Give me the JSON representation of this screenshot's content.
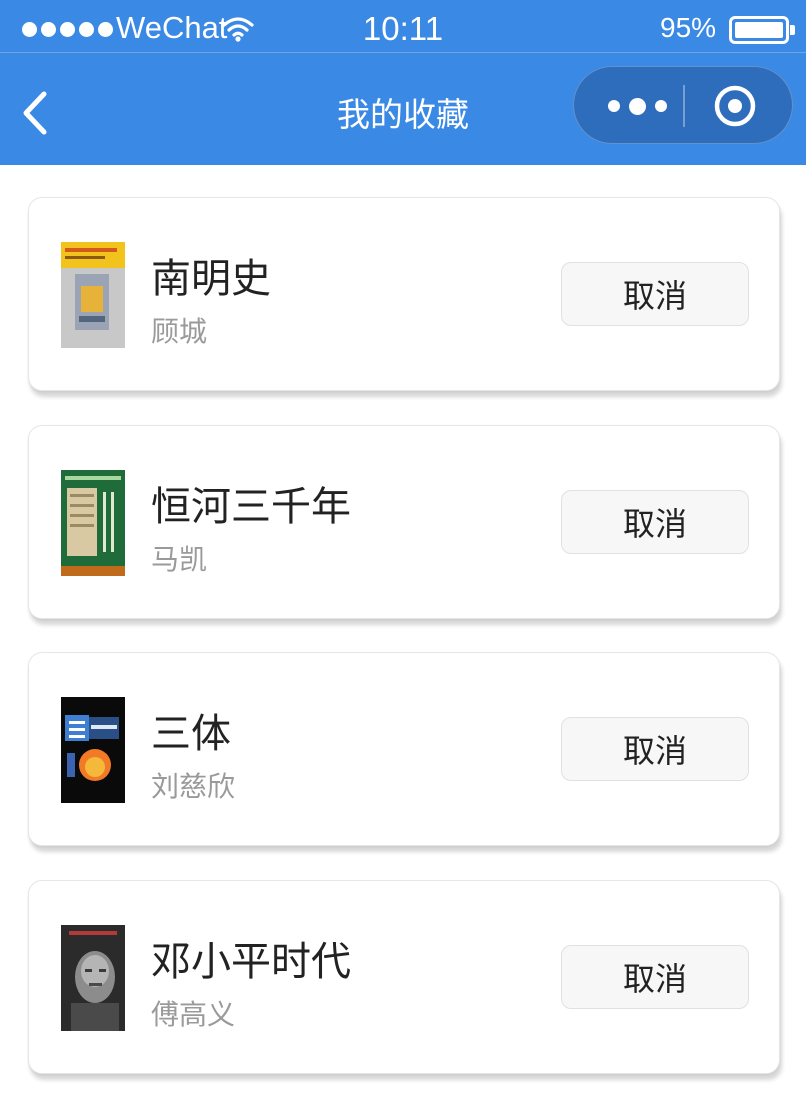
{
  "status_bar": {
    "carrier": "WeChat",
    "time": "10:11",
    "battery": "95%"
  },
  "nav": {
    "title": "我的收藏"
  },
  "favorites": [
    {
      "title": "南明史",
      "author": "顾城",
      "cancel_label": "取消"
    },
    {
      "title": "恒河三千年",
      "author": "马凯",
      "cancel_label": "取消"
    },
    {
      "title": "三体",
      "author": "刘慈欣",
      "cancel_label": "取消"
    },
    {
      "title": "邓小平时代",
      "author": "傅高义",
      "cancel_label": "取消"
    }
  ],
  "icons": [
    "signal-dots-icon",
    "wifi-icon",
    "battery-icon",
    "back-chevron-icon",
    "more-dots-icon",
    "close-target-icon"
  ],
  "colors": {
    "header": "#3a89e4",
    "capsule": "#2e6dbb",
    "author_text": "#9a9a9a"
  }
}
